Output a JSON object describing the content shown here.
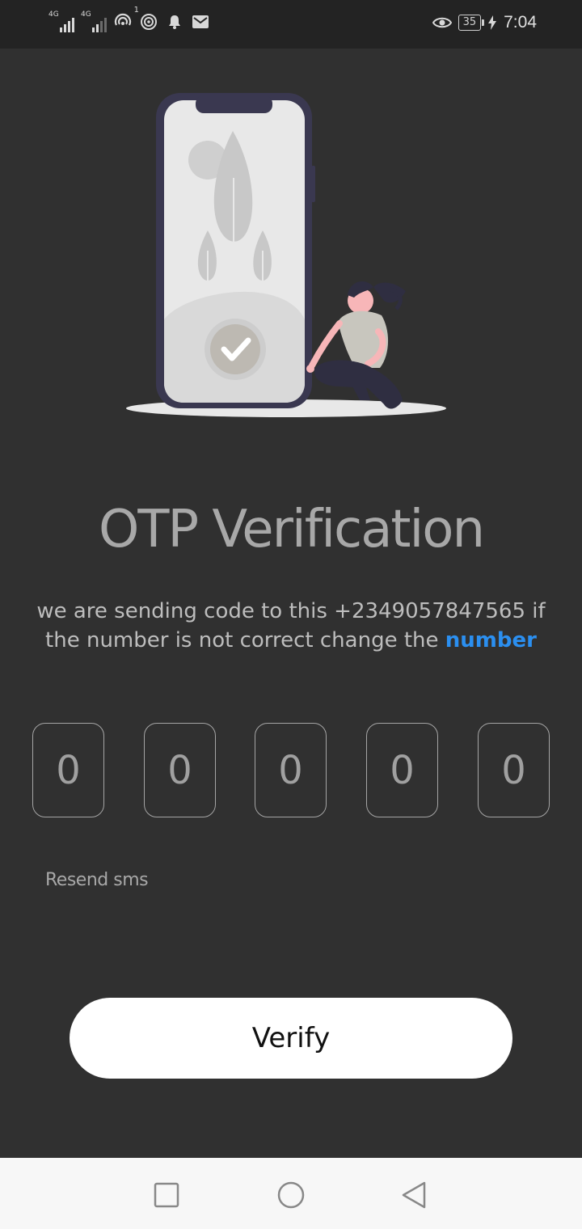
{
  "status_bar": {
    "network_1": "4G",
    "network_2": "4G",
    "hotspot_badge": "1",
    "battery_level": "35",
    "time": "7:04",
    "icons": [
      "signal-icon",
      "signal-icon",
      "hotspot-icon",
      "wifi-tether-icon",
      "bell-icon",
      "mail-icon",
      "eye-icon",
      "battery-icon",
      "charging-icon"
    ]
  },
  "page": {
    "title": "OTP Verification",
    "description_prefix": "we are sending code to this +2349057847565 if the number is not correct change the ",
    "change_link": "number",
    "otp_digits": [
      "0",
      "0",
      "0",
      "0",
      "0"
    ],
    "resend_label": "Resend sms",
    "verify_label": "Verify"
  },
  "colors": {
    "background": "#303030",
    "status_bar": "#232323",
    "link": "#2b8ff0",
    "button_bg": "#ffffff",
    "nav_bar": "#f7f7f7"
  },
  "nav_bar": {
    "icons": [
      "recent-apps-icon",
      "home-icon",
      "back-icon"
    ]
  }
}
